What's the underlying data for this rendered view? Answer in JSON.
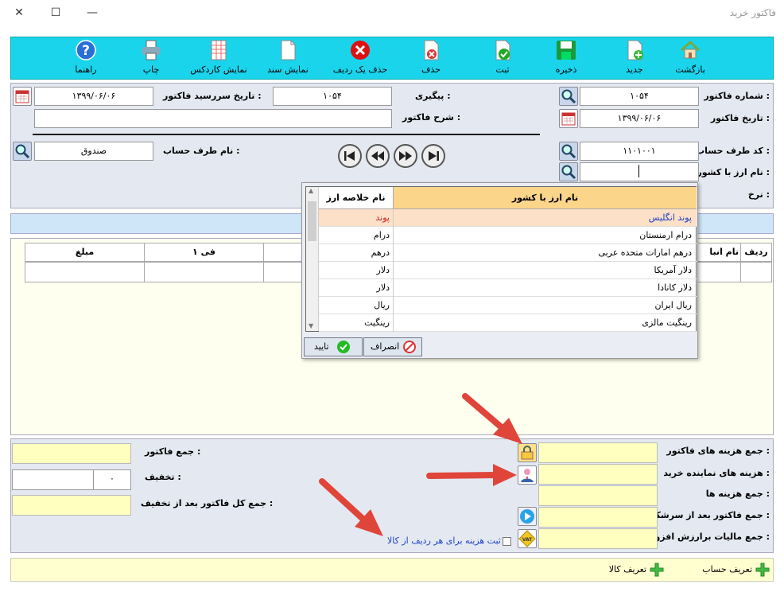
{
  "window": {
    "title": "فاکتور خرید",
    "minimize": "—",
    "maximize": "☐",
    "close": "✕"
  },
  "toolbar": [
    {
      "id": "back",
      "label": "بازگشت",
      "icon": "home-icon"
    },
    {
      "id": "new",
      "label": "جدید",
      "icon": "new-doc-icon"
    },
    {
      "id": "save",
      "label": "ذخیره",
      "icon": "save-icon"
    },
    {
      "id": "register",
      "label": "ثبت",
      "icon": "register-icon"
    },
    {
      "id": "delete",
      "label": "حذف",
      "icon": "delete-doc-icon"
    },
    {
      "id": "delete_row",
      "label": "حذف یک ردیف",
      "icon": "delete-row-icon"
    },
    {
      "id": "show_doc",
      "label": "نمایش سند",
      "icon": "document-icon"
    },
    {
      "id": "cardex",
      "label": "نمایش کاردکس",
      "icon": "cardex-icon"
    },
    {
      "id": "print",
      "label": "چاپ",
      "icon": "printer-icon"
    },
    {
      "id": "help",
      "label": "راهنما",
      "icon": "help-icon"
    }
  ],
  "header": {
    "invoice_no_label": "شماره فاکتور :",
    "invoice_no": "۱۰۵۴",
    "invoice_date_label": "تاریخ فاکتور :",
    "invoice_date": "۱۳۹۹/۰۶/۰۶",
    "tracking_label": "پیگیری :",
    "tracking": "۱۰۵۴",
    "due_date_label": "تاریخ سررسید فاکتور :",
    "due_date": "۱۳۹۹/۰۶/۰۶",
    "description_label": "شرح فاکتور :",
    "description": "",
    "account_code_label": "کد طرف حساب :",
    "account_code": "۱۱۰۱۰۰۱",
    "account_name_label": "نام طرف حساب :",
    "account_name": "صندوق",
    "currency_label": "نام ارز با کشور :",
    "currency": "",
    "rate_label": "نرخ :"
  },
  "grid": {
    "columns": [
      "ردیف",
      "نام انبا",
      "فی ۱",
      "مبلغ"
    ]
  },
  "currency_popup": {
    "col_name": "نام ارز با کشور",
    "col_short": "نام خلاصه ارز",
    "rows": [
      {
        "name": "پوند انگلیس",
        "short": "پوند"
      },
      {
        "name": "درام ارمنستان",
        "short": "درام"
      },
      {
        "name": "درهم امارات متحده عربی",
        "short": "درهم"
      },
      {
        "name": "دلار آمریکا",
        "short": "دلار"
      },
      {
        "name": "دلار کانادا",
        "short": "دلار"
      },
      {
        "name": "ریال ایران",
        "short": "ریال"
      },
      {
        "name": "رینگیت مالزی",
        "short": "رینگیت"
      }
    ],
    "cancel": "انصراف",
    "confirm": "تایید"
  },
  "totals": {
    "invoice_costs_label": "جمع هزینه های فاکتور :",
    "agent_costs_label": "هزینه های نماینده خرید :",
    "costs_total_label": "جمع هزینه ها :",
    "after_rounding_label": "جمع فاکتور بعد از سرشکن :",
    "vat_label": "جمع مالیات برارزش افزوده :",
    "invoice_total_label": "جمع فاکتور :",
    "discount_label": "تخفیف :",
    "discount_value": "۰",
    "after_discount_label": "جمع کل فاکتور بعد از تخفیف :",
    "per_row_cost_label": "ثبت هزینه برای هر ردیف از کالا"
  },
  "footer": {
    "define_account": "تعریف حساب",
    "define_goods": "تعریف کالا"
  },
  "colors": {
    "toolbar": "#1ad4ec",
    "highlight_row": "#fde0c8",
    "yellow_field": "#ffffbf",
    "arrow": "#e0453a"
  }
}
